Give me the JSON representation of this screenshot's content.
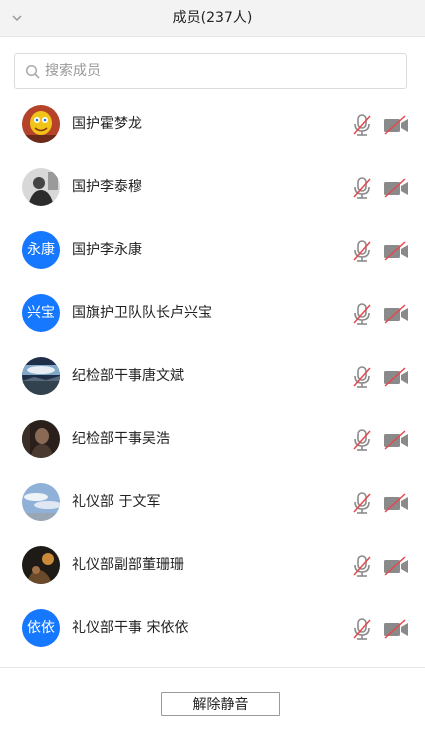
{
  "header": {
    "title": "成员(237人)"
  },
  "search": {
    "placeholder": "搜索成员",
    "value": ""
  },
  "members": [
    {
      "name": "国护霍梦龙",
      "avatar": "photo",
      "mic": "muted",
      "camera": "off"
    },
    {
      "name": "国护李泰穆",
      "avatar": "photo",
      "mic": "muted",
      "camera": "off"
    },
    {
      "name": "国护李永康",
      "avatar": "text",
      "avatar_text": "永康",
      "mic": "muted",
      "camera": "off"
    },
    {
      "name": "国旗护卫队队长卢兴宝",
      "avatar": "text",
      "avatar_text": "兴宝",
      "mic": "muted",
      "camera": "off"
    },
    {
      "name": "纪检部干事唐文斌",
      "avatar": "photo",
      "mic": "muted",
      "camera": "off"
    },
    {
      "name": "纪检部干事吴浩",
      "avatar": "photo",
      "mic": "muted",
      "camera": "off"
    },
    {
      "name": "礼仪部 于文军",
      "avatar": "photo",
      "mic": "muted",
      "camera": "off"
    },
    {
      "name": "礼仪部副部董珊珊",
      "avatar": "photo",
      "mic": "muted",
      "camera": "off"
    },
    {
      "name": "礼仪部干事 宋依依",
      "avatar": "text",
      "avatar_text": "依依",
      "mic": "muted",
      "camera": "off"
    }
  ],
  "footer": {
    "unmute_label": "解除静音"
  },
  "colors": {
    "accent": "#1677ff",
    "muted_slash": "#e5484d",
    "icon_gray": "#8a8a8a"
  }
}
